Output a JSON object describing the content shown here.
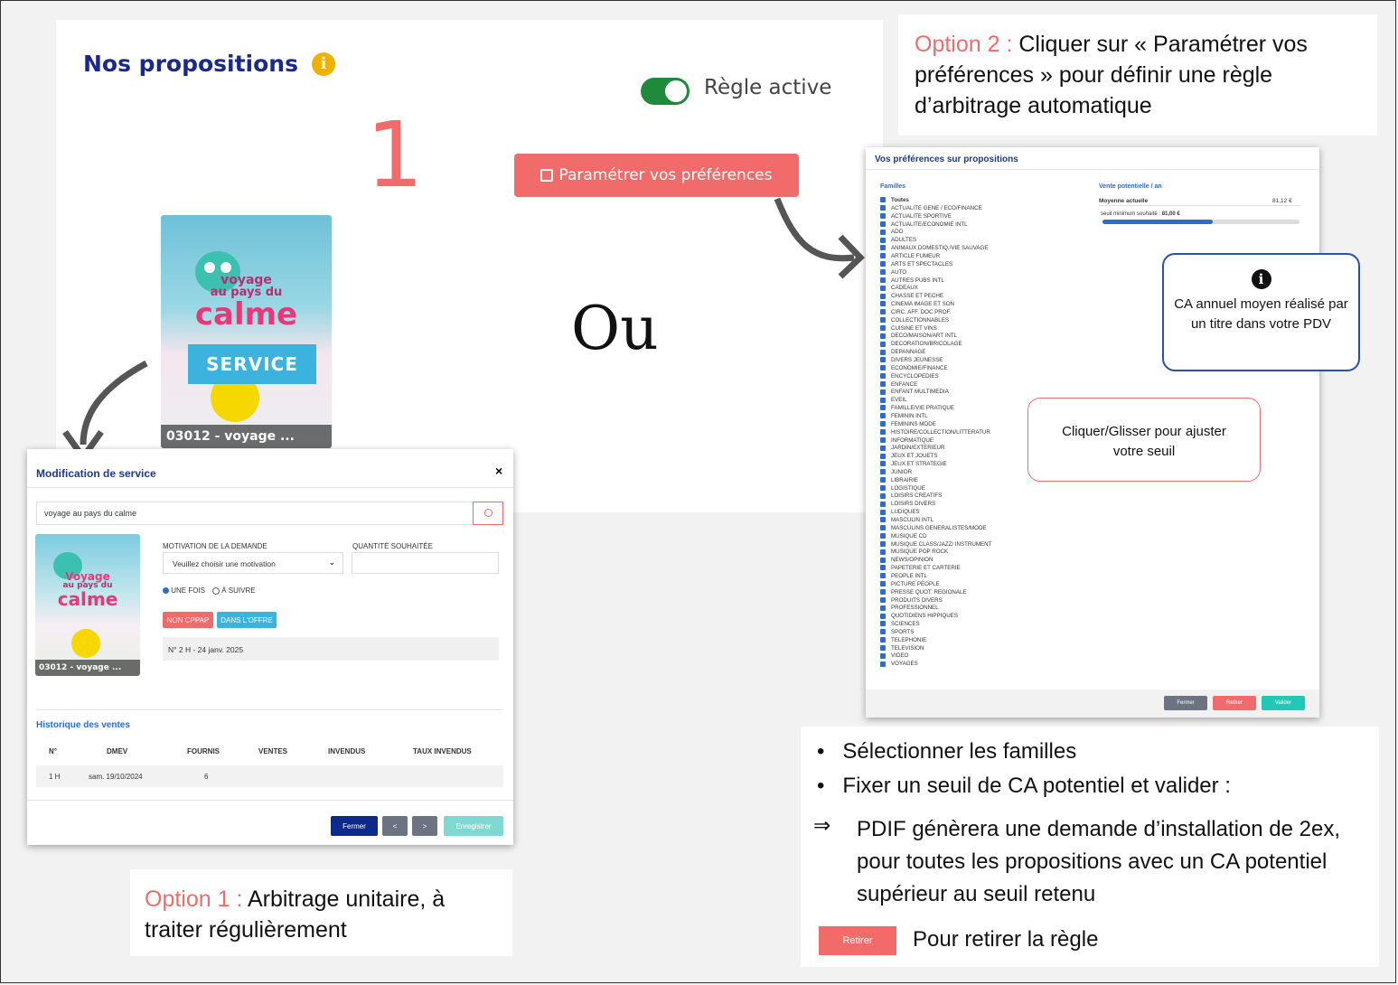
{
  "main": {
    "title": "Nos propositions",
    "info_icon": "info-circle-icon",
    "toggle_label": "Règle active",
    "big_number": "1",
    "pref_button": "Paramétrer vos préférences",
    "ou": "Ou",
    "service_tag": "SERVICE",
    "cover": {
      "title_line1": "voyage",
      "title_line2": "au pays du",
      "title_line3": "calme",
      "footer": "03012 - voyage ..."
    }
  },
  "option2": {
    "prefix": "Option 2 : ",
    "text": "Cliquer sur « Paramétrer vos préférences » pour définir une règle d’arbitrage automatique"
  },
  "option1": {
    "prefix": "Option 1 : ",
    "text": "Arbitrage unitaire, à traiter régulièrement"
  },
  "modal": {
    "title": "Modification de service",
    "close": "×",
    "search_value": "voyage au pays du calme",
    "motivation_label": "MOTIVATION DE LA DEMANDE",
    "quantity_label": "QUANTITÉ SOUHAITÉE",
    "motivation_placeholder": "Veuillez choisir une motivation",
    "radio1": "UNE FOIS",
    "radio2": "À SUIVRE",
    "badge1": "NON CPPAP",
    "badge2": "DANS L'OFFRE",
    "issue": "N° 2 H - 24 janv. 2025",
    "cover_footer": "03012 - voyage ...",
    "cover_title1": "Voyage",
    "cover_title2": "au pays du",
    "cover_title3": "calme",
    "history_title": "Historique des ventes",
    "table_headers": [
      "N°",
      "DMEV",
      "FOURNIS",
      "VENTES",
      "INVENDUS",
      "TAUX INVENDUS"
    ],
    "table_row": [
      "1 H",
      "sam. 19/10/2024",
      "6",
      "",
      "",
      ""
    ],
    "btn_close": "Fermer",
    "btn_prev": "<",
    "btn_next": ">",
    "btn_save": "Enregistrer"
  },
  "pref": {
    "title": "Vos préférences sur propositions",
    "families_header": "Familles",
    "sales_header": "Vente potentielle / an",
    "avg_label": "Moyenne actuelle",
    "avg_value": "81,12 €",
    "threshold_label": "seuil minimum souhaité : ",
    "threshold_value": "81,00 €",
    "slider_level": 0.56,
    "families": [
      "Toutes",
      "ACTUALITE GENE / ECO/FINANCE",
      "ACTUALITE SPORTIVE",
      "ACTUALITE/ECONOMIE INTL",
      "ADO",
      "ADULTES",
      "ANIMAUX DOMESTIQ./VIE SAUVAGE",
      "ARTICLE FUMEUR",
      "ARTS ET SPECTACLES",
      "AUTO",
      "AUTRES PUBS INTL",
      "CADEAUX",
      "CHASSE ET PECHE",
      "CINEMA IMAGE ET SON",
      "CIRC. AFF. DOC PROF.",
      "COLLECTIONNABLES",
      "CUISINE ET VINS",
      "DECO/MAISON/ART INTL",
      "DECORATION/BRICOLAGE",
      "DEPANNAGE",
      "DIVERS JEUNESSE",
      "ECONOMIE/FINANCE",
      "ENCYCLOPEDIES",
      "ENFANCE",
      "ENFANT MULTIMEDIA",
      "EVEIL",
      "FAMILLE/VIE PRATIQUE",
      "FEMININ INTL",
      "FEMININS MODE",
      "HISTOIRE/COLLECTION/LITTERATUR",
      "INFORMATIQUE",
      "JARDIN/EXTERIEUR",
      "JEUX ET JOUETS",
      "JEUX ET STRATEGIE",
      "JUNIOR",
      "LIBRAIRIE",
      "LOGISTIQUE",
      "LOISIRS CREATIFS",
      "LOISIRS DIVERS",
      "LUDIQUES",
      "MASCULIN INTL",
      "MASCULINS GENERALISTES/MODE",
      "MUSIQUE CD",
      "MUSIQUE CLASS/JAZZ/ INSTRUMENT",
      "MUSIQUE POP ROCK",
      "NEWS/OPINION",
      "PAPETERIE ET CARTERIE",
      "PEOPLE INTL",
      "PICTURE PEOPLE",
      "PRESSE QUOT. REGIONALE",
      "PRODUITS DIVERS",
      "PROFESSIONNEL",
      "QUOTIDIENS HIPPIQUES",
      "SCIENCES",
      "SPORTS",
      "TELEPHONIE",
      "TELEVISION",
      "VIDEO",
      "VOYAGES"
    ],
    "btn_close": "Fermer",
    "btn_remove": "Retirer",
    "btn_validate": "Valider"
  },
  "bubble_info": {
    "icon": "info-circle-icon",
    "text": "CA annuel moyen réalisé par un titre dans votre PDV"
  },
  "bubble_slide": {
    "text": "Cliquer/Glisser pour ajuster votre seuil"
  },
  "steps": {
    "bullet1": "Sélectionner les familles",
    "bullet2": "Fixer un seuil de CA potentiel et valider :",
    "arrow": "⇒",
    "result": "PDIF génèrera une demande d’installation de 2ex, pour toutes les propositions avec un CA potentiel supérieur au seuil retenu",
    "remove_btn": "Retirer",
    "remove_text": "Pour retirer la règle"
  },
  "colors": {
    "accent_red": "#f26b6b",
    "navy": "#1a2a8a",
    "toggle_green": "#1f8a3b",
    "teal": "#22c7b5"
  }
}
